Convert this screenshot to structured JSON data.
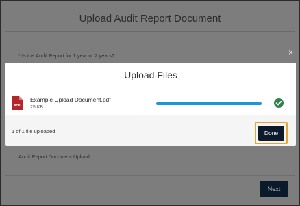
{
  "page": {
    "title": "Upload Audit Report Document",
    "question_label": "Is the Audit Report for 1 year or 2 years?",
    "document_caption": "Audit Report Document Upload",
    "next_label": "Next",
    "close_icon": "×"
  },
  "modal": {
    "title": "Upload Files",
    "file": {
      "name": "Example Upload Document.pdf",
      "size": "25 KB",
      "icon": "pdf-file-icon",
      "progress": 1.0,
      "status_icon": "check-circle-icon"
    },
    "status_text": "1 of 1 file uploaded",
    "done_label": "Done"
  },
  "colors": {
    "overlay": "#7d7d7d",
    "primary_button": "#0d1a2b",
    "progress": "#1b96d6",
    "success": "#2e844a",
    "highlight": "#e8a531",
    "pdf_icon": "#b4262b"
  }
}
